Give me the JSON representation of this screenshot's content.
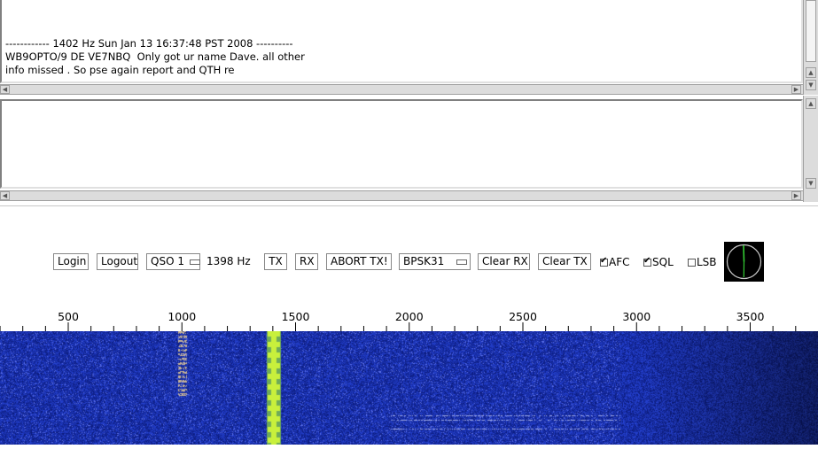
{
  "rx_panel": {
    "lines": [
      "------------ 1402 Hz Sun Jan 13 16:37:48 PST 2008 ----------",
      "WB9OPTO/9 DE VE7NBQ  Only got ur name Dave. all other",
      "info missed . So pse again report and QTH re"
    ]
  },
  "tx_panel": {
    "text": ""
  },
  "toolbar": {
    "login_label": "Login",
    "logout_label": "Logout",
    "qso_selected": "QSO 1",
    "frequency": "1398 Hz",
    "tx_label": "TX",
    "rx_label": "RX",
    "abort_label": "ABORT TX!",
    "mode_selected": "BPSK31",
    "clear_rx_label": "Clear RX",
    "clear_tx_label": "Clear TX",
    "afc": {
      "label": "AFC",
      "checked": true
    },
    "sql": {
      "label": "SQL",
      "checked": true
    },
    "lsb": {
      "label": "LSB",
      "checked": false
    }
  },
  "frequency_scale": {
    "ticks": [
      {
        "label": "500",
        "value": 500
      },
      {
        "label": "1000",
        "value": 1000
      },
      {
        "label": "1500",
        "value": 1500
      },
      {
        "label": "2000",
        "value": 2000
      },
      {
        "label": "2500",
        "value": 2500
      },
      {
        "label": "3000",
        "value": 3000
      },
      {
        "label": "3500",
        "value": 3500
      }
    ]
  },
  "waterfall": {
    "signals_hz": [
      1000,
      1402,
      1430
    ]
  },
  "colors": {
    "waterfall_background": "#1a2fa0",
    "signal_strong": "#c8f03c",
    "phase_scope_background": "#000000",
    "phase_scope_ring": "#c8c8c8",
    "phase_scope_needle": "#33cc33"
  },
  "icons": {
    "scroll_left": "arrow-left-icon",
    "scroll_right": "arrow-right-icon",
    "scroll_up": "arrow-up-icon",
    "scroll_down": "arrow-down-icon",
    "combo": "dropdown-icon",
    "phase_scope": "phase-scope-icon"
  }
}
